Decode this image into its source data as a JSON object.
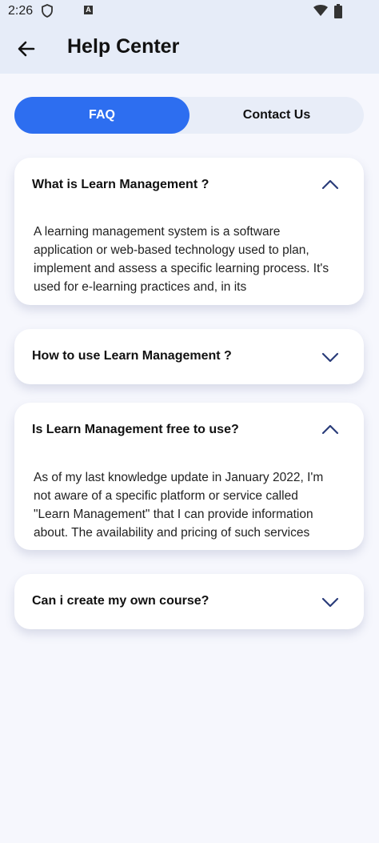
{
  "status": {
    "time": "2:26"
  },
  "appbar": {
    "title": "Help Center"
  },
  "tabs": {
    "faq": "FAQ",
    "contact": "Contact Us"
  },
  "faqs": [
    {
      "question": "What is Learn Management ?",
      "expanded": true,
      "answer": "A learning management system is a software application or web-based technology used to plan, implement and assess a specific learning process. It's used for e-learning practices and, in its"
    },
    {
      "question": "How to use Learn Management ?",
      "expanded": false
    },
    {
      "question": "Is Learn Management free to use?",
      "expanded": true,
      "answer": "As of my last knowledge update in January 2022, I'm not aware of a specific platform or service called \"Learn Management\" that I can provide information about. The availability and pricing of such services"
    },
    {
      "question": "Can i create my own course?",
      "expanded": false
    }
  ],
  "colors": {
    "accent": "#2d6ef0",
    "chevron": "#2a3c7a"
  }
}
